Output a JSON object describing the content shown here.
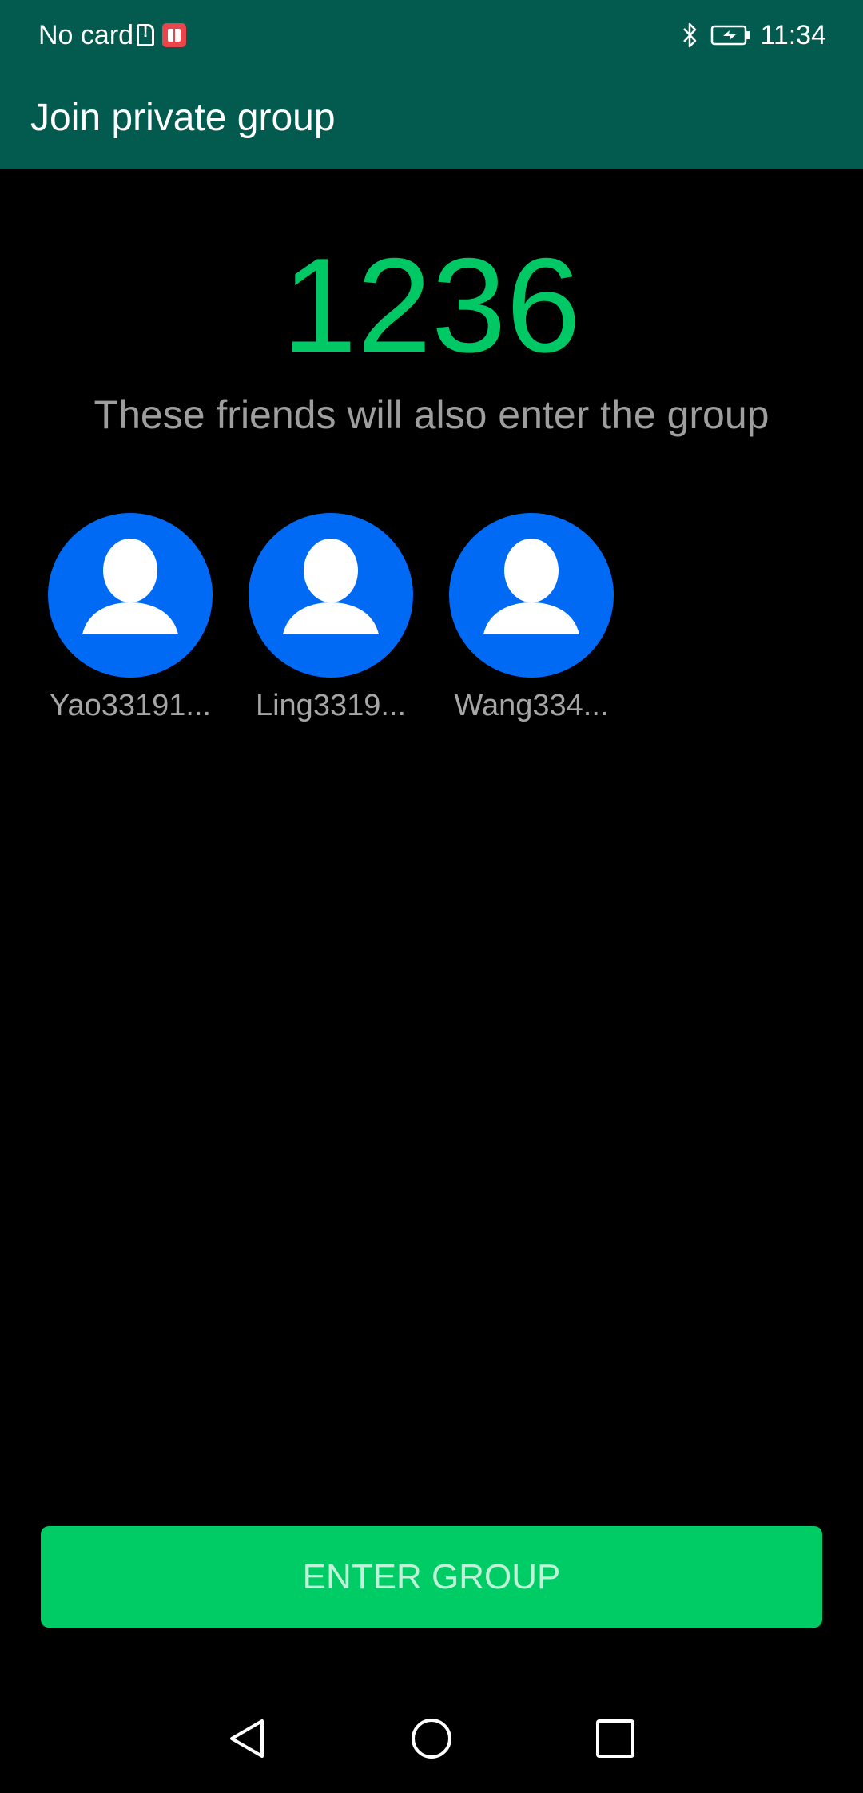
{
  "status_bar": {
    "carrier": "No card",
    "time": "11:34",
    "icons": [
      "sim-alert-icon",
      "book-icon",
      "bluetooth-icon",
      "battery-charging-icon"
    ]
  },
  "app_bar": {
    "title": "Join private group"
  },
  "group": {
    "number": "1236",
    "subtitle": "These friends will also enter the group"
  },
  "friends": [
    {
      "name": "Yao33191..."
    },
    {
      "name": "Ling3319..."
    },
    {
      "name": "Wang334..."
    }
  ],
  "actions": {
    "enter_label": "ENTER GROUP"
  },
  "nav": {
    "icons": [
      "back-icon",
      "home-icon",
      "recents-icon"
    ]
  },
  "colors": {
    "header": "#025B4E",
    "accent_green": "#00C864",
    "button_green": "#00CC66",
    "avatar_blue": "#006AF5",
    "background": "#000000"
  }
}
